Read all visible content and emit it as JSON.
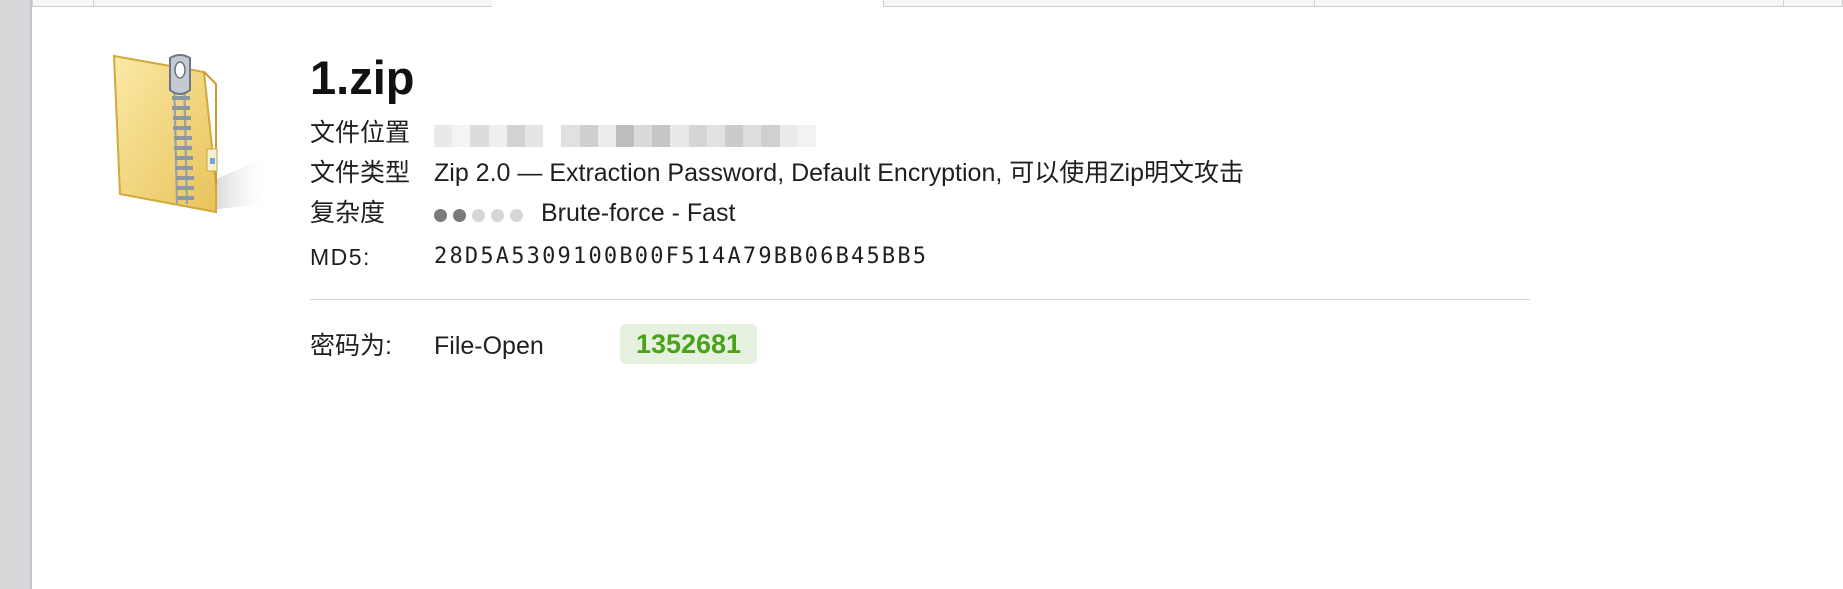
{
  "file": {
    "name": "1.zip",
    "location_label": "文件位置",
    "type_label": "文件类型",
    "type_value": "Zip 2.0 — Extraction Password, Default Encryption, 可以使用Zip明文攻击",
    "complexity_label": "复杂度",
    "complexity_value": "Brute-force - Fast",
    "complexity_level": 2,
    "complexity_max": 5,
    "md5_label": "MD5:",
    "md5_value": "28D5A5309100B00F514A79BB06B45BB5"
  },
  "result": {
    "password_label": "密码为:",
    "password_type": "File-Open",
    "password_value": "1352681"
  },
  "icons": {
    "file_icon": "zip-folder-icon"
  },
  "colors": {
    "password_text": "#4aa21a",
    "password_bg": "#e6f2df",
    "dot_filled": "#7a7a7a",
    "dot_empty": "#d6d6d6"
  }
}
